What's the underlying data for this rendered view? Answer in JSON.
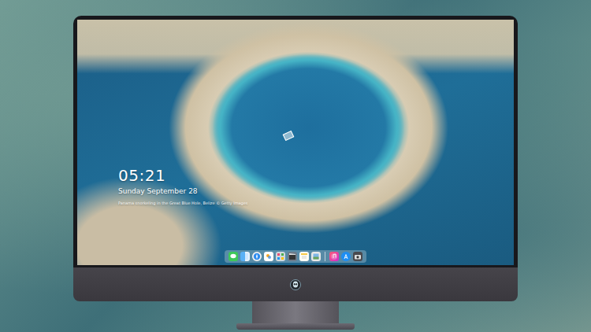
{
  "screen": {
    "lockscreen": {
      "time": "05:21",
      "date": "Sunday September 28",
      "caption": "Panama snorkeling in the Great Blue Hole, Belize © Getty Images"
    }
  },
  "dock": {
    "items": [
      {
        "kind": "messages"
      },
      {
        "kind": "finder"
      },
      {
        "kind": "safari"
      },
      {
        "kind": "photos"
      },
      {
        "kind": "launcher"
      },
      {
        "kind": "video"
      },
      {
        "kind": "notes"
      },
      {
        "kind": "preview"
      },
      {
        "kind": "separator"
      },
      {
        "kind": "music"
      },
      {
        "kind": "appstore"
      },
      {
        "kind": "camera"
      }
    ]
  }
}
